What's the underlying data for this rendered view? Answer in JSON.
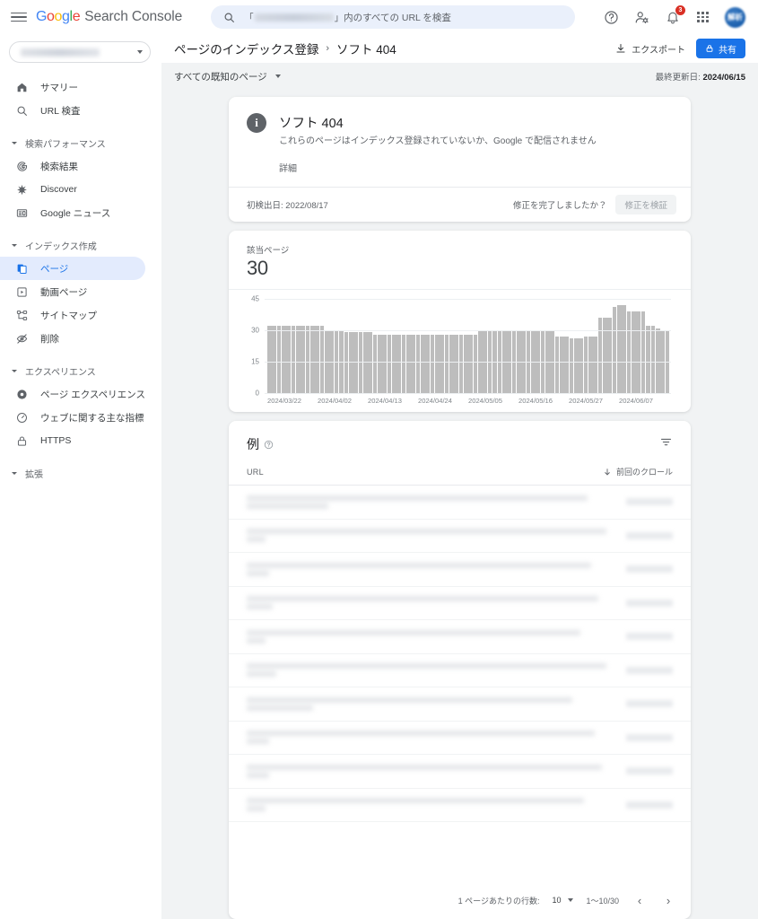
{
  "header": {
    "menu_label": "メインメニュー",
    "brand_google": "Google",
    "brand_product": "Search Console",
    "search": {
      "prefix": "「",
      "suffix": "」内のすべての URL を検査",
      "value": ""
    },
    "help_label": "ヘルプ",
    "accounts_label": "アカウント設定",
    "notifications_label": "通知",
    "notifications_count": "3",
    "apps_label": "Google アプリ",
    "avatar_label": "解析"
  },
  "property_selector": {
    "value": "",
    "placeholder": "プロパティを選択"
  },
  "sidebar": {
    "items": [
      {
        "label": "サマリー",
        "icon": "home-icon",
        "active": false
      },
      {
        "label": "URL 検査",
        "icon": "search-icon",
        "active": false
      }
    ],
    "groups": [
      {
        "label": "検索パフォーマンス",
        "items": [
          {
            "label": "検索結果",
            "icon": "google-g-icon",
            "active": false
          },
          {
            "label": "Discover",
            "icon": "discover-icon",
            "active": false
          },
          {
            "label": "Google ニュース",
            "icon": "news-icon",
            "active": false
          }
        ]
      },
      {
        "label": "インデックス作成",
        "items": [
          {
            "label": "ページ",
            "icon": "pages-icon",
            "active": true
          },
          {
            "label": "動画ページ",
            "icon": "video-icon",
            "active": false
          },
          {
            "label": "サイトマップ",
            "icon": "sitemap-icon",
            "active": false
          },
          {
            "label": "削除",
            "icon": "eye-off-icon",
            "active": false
          }
        ]
      },
      {
        "label": "エクスペリエンス",
        "items": [
          {
            "label": "ページ エクスペリエンス",
            "icon": "experience-icon",
            "active": false
          },
          {
            "label": "ウェブに関する主な指標",
            "icon": "vitals-icon",
            "active": false
          },
          {
            "label": "HTTPS",
            "icon": "lock-icon",
            "active": false
          }
        ]
      },
      {
        "label": "拡張",
        "items": []
      }
    ]
  },
  "main": {
    "breadcrumb": {
      "parent": "ページのインデックス登録",
      "separator": "›",
      "current": "ソフト 404"
    },
    "export_label": "エクスポート",
    "share_label": "共有",
    "filter_chip": "すべての既知のページ",
    "updated_prefix": "最終更新日:",
    "updated_date": "2024/06/15"
  },
  "status_card": {
    "icon": "info-icon",
    "title": "ソフト 404",
    "description": "これらのページはインデックス登録されていないか、Google で配信されません",
    "detail_link": "詳細",
    "first_detected_label": "初検出日:",
    "first_detected_date": "2022/08/17",
    "fix_question": "修正を完了しましたか？",
    "verify_button": "修正を検証"
  },
  "chart_card": {
    "metric_label": "該当ページ",
    "metric_value": "30"
  },
  "chart_data": {
    "type": "bar",
    "title": "該当ページ",
    "xlabel": "",
    "ylabel": "",
    "ylim": [
      0,
      45
    ],
    "yticks": [
      0,
      15,
      30,
      45
    ],
    "grid": true,
    "legend": "none",
    "bar_color": "#bdbdbd",
    "tick_labels": [
      "2024/03/22",
      "2024/04/02",
      "2024/04/13",
      "2024/04/24",
      "2024/05/05",
      "2024/05/16",
      "2024/05/27",
      "2024/06/07"
    ],
    "tick_indices": [
      0,
      11,
      22,
      33,
      44,
      55,
      66,
      77
    ],
    "x": [
      "2024/03/22",
      "2024/03/23",
      "2024/03/24",
      "2024/03/25",
      "2024/03/26",
      "2024/03/27",
      "2024/03/28",
      "2024/03/29",
      "2024/03/30",
      "2024/03/31",
      "2024/04/01",
      "2024/04/02",
      "2024/04/03",
      "2024/04/04",
      "2024/04/05",
      "2024/04/06",
      "2024/04/07",
      "2024/04/08",
      "2024/04/09",
      "2024/04/10",
      "2024/04/11",
      "2024/04/12",
      "2024/04/13",
      "2024/04/14",
      "2024/04/15",
      "2024/04/16",
      "2024/04/17",
      "2024/04/18",
      "2024/04/19",
      "2024/04/20",
      "2024/04/21",
      "2024/04/22",
      "2024/04/23",
      "2024/04/24",
      "2024/04/25",
      "2024/04/26",
      "2024/04/27",
      "2024/04/28",
      "2024/04/29",
      "2024/04/30",
      "2024/05/01",
      "2024/05/02",
      "2024/05/03",
      "2024/05/04",
      "2024/05/05",
      "2024/05/06",
      "2024/05/07",
      "2024/05/08",
      "2024/05/09",
      "2024/05/10",
      "2024/05/11",
      "2024/05/12",
      "2024/05/13",
      "2024/05/14",
      "2024/05/15",
      "2024/05/16",
      "2024/05/17",
      "2024/05/18",
      "2024/05/19",
      "2024/05/20",
      "2024/05/21",
      "2024/05/22",
      "2024/05/23",
      "2024/05/24",
      "2024/05/25",
      "2024/05/26",
      "2024/05/27",
      "2024/05/28",
      "2024/05/29",
      "2024/05/30",
      "2024/05/31",
      "2024/06/01",
      "2024/06/02",
      "2024/06/03",
      "2024/06/04",
      "2024/06/05",
      "2024/06/06",
      "2024/06/07",
      "2024/06/08",
      "2024/06/09",
      "2024/06/10",
      "2024/06/11",
      "2024/06/12",
      "2024/06/13"
    ],
    "values": [
      32,
      32,
      32,
      32,
      32,
      32,
      32,
      32,
      32,
      32,
      32,
      32,
      30,
      30,
      30,
      30,
      29,
      29,
      29,
      29,
      29,
      29,
      28,
      28,
      28,
      28,
      28,
      28,
      28,
      28,
      28,
      28,
      28,
      28,
      28,
      28,
      28,
      28,
      28,
      28,
      28,
      28,
      28,
      28,
      30,
      30,
      30,
      30,
      30,
      30,
      30,
      30,
      30,
      30,
      30,
      30,
      30,
      30,
      30,
      30,
      27,
      27,
      27,
      26,
      26,
      26,
      27,
      27,
      27,
      36,
      36,
      36,
      41,
      42,
      42,
      39,
      39,
      39,
      39,
      32,
      32,
      31,
      30,
      30
    ]
  },
  "examples_card": {
    "title": "例",
    "help_icon": "help-circle-icon",
    "filter_icon": "filter-icon",
    "columns": {
      "url": "URL",
      "last_crawl": "前回のクロール"
    },
    "rows": [
      {
        "url": "",
        "last_crawl": "",
        "redacted": true,
        "lines": 2
      },
      {
        "url": "",
        "last_crawl": "",
        "redacted": true,
        "lines": 2
      },
      {
        "url": "",
        "last_crawl": "",
        "redacted": true,
        "lines": 2
      },
      {
        "url": "",
        "last_crawl": "",
        "redacted": true,
        "lines": 2
      },
      {
        "url": "",
        "last_crawl": "",
        "redacted": true,
        "lines": 2
      },
      {
        "url": "",
        "last_crawl": "",
        "redacted": true,
        "lines": 2
      },
      {
        "url": "",
        "last_crawl": "",
        "redacted": true,
        "lines": 2
      },
      {
        "url": "",
        "last_crawl": "",
        "redacted": true,
        "lines": 2
      },
      {
        "url": "",
        "last_crawl": "",
        "redacted": true,
        "lines": 2
      },
      {
        "url": "",
        "last_crawl": "",
        "redacted": true,
        "lines": 2
      }
    ],
    "pager": {
      "rows_per_page_label": "1 ページあたりの行数:",
      "rows_per_page_value": "10",
      "range_label": "1～10/30",
      "prev_label": "‹",
      "next_label": "›"
    }
  },
  "colors": {
    "accent": "#1a73e8",
    "bar": "#bdbdbd",
    "active_nav_bg": "#e3ebfd",
    "page_bg": "#f1f3f4",
    "badge": "#d93025"
  }
}
